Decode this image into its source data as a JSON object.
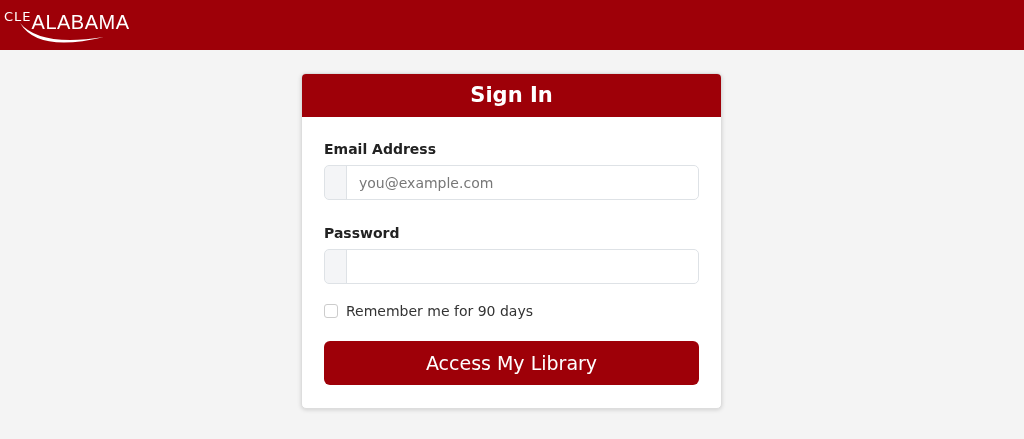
{
  "header": {
    "logo": {
      "prefix": "CLE",
      "name": "ALABAMA"
    }
  },
  "card": {
    "title": "Sign In",
    "fields": [
      {
        "label": "Email Address",
        "placeholder": "you@example.com"
      },
      {
        "label": "Password"
      }
    ],
    "remember": {
      "label": "Remember me for 90 days",
      "checked": false
    },
    "submit": "Access My Library"
  }
}
